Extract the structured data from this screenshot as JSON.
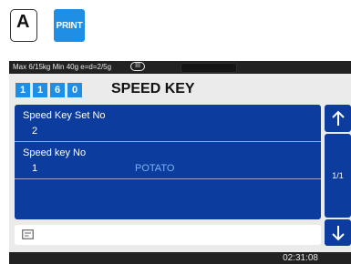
{
  "top_keys": {
    "key_a": "A",
    "print": "PRINT"
  },
  "status_bar": {
    "spec": "Max 6/15kg Min 40g e=d=2/5g",
    "accuracy_class": "III"
  },
  "header": {
    "code_digits": [
      "1",
      "1",
      "6",
      "0"
    ],
    "title": "SPEED KEY"
  },
  "fields": {
    "set_no": {
      "label": "Speed Key Set No",
      "value": "2"
    },
    "key_no": {
      "label": "Speed key No",
      "value": "1",
      "name": "POTATO"
    }
  },
  "pager": {
    "page": "1/1"
  },
  "icons": {
    "up": "arrow-up-icon",
    "down": "arrow-down-icon",
    "memo": "memo-icon"
  },
  "clock": "02:31:08",
  "colors": {
    "accent": "#1f8fe6",
    "panel": "#0b3c9e",
    "item_name": "#7eb2f2",
    "screen_bg": "#ebebeb",
    "bar": "#222222"
  }
}
